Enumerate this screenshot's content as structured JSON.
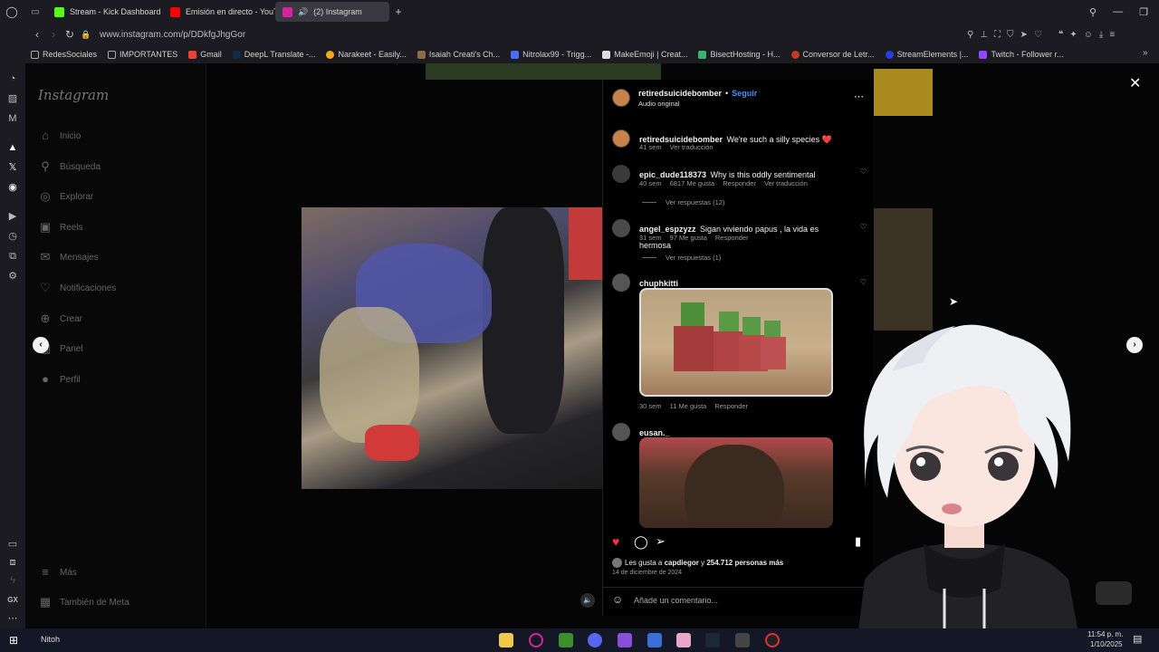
{
  "browser": {
    "tabs": [
      {
        "label": "Stream - Kick Dashboard",
        "color": "#53fc18"
      },
      {
        "label": "Emisión en directo - YouT",
        "color": "#ff0000"
      },
      {
        "label": "(2) Instagram",
        "color": "#d6249f"
      }
    ],
    "url": "www.instagram.com/p/DDkfgJhgGor",
    "bookmarks": [
      "RedesSociales",
      "IMPORTANTES",
      "Gmail",
      "DeepL Translate -...",
      "Narakeet - Easily...",
      "Isaiah Creati's Ch...",
      "Nitrolax99 - Trigg...",
      "MakeEmoji | Creat...",
      "BisectHosting - H...",
      "Conversor de Letr...",
      "StreamElements |...",
      "Twitch - Follower r..."
    ]
  },
  "instagram": {
    "logo": "Instagram",
    "nav": [
      {
        "label": "Inicio",
        "icon": "home-icon",
        "glyph": "⌂"
      },
      {
        "label": "Búsqueda",
        "icon": "search-icon",
        "glyph": "⚲"
      },
      {
        "label": "Explorar",
        "icon": "compass-icon",
        "glyph": "◎"
      },
      {
        "label": "Reels",
        "icon": "reels-icon",
        "glyph": "▣"
      },
      {
        "label": "Mensajes",
        "icon": "messenger-icon",
        "glyph": "✉"
      },
      {
        "label": "Notificaciones",
        "icon": "heart-icon",
        "glyph": "♡"
      },
      {
        "label": "Crear",
        "icon": "plus-icon",
        "glyph": "⊕"
      },
      {
        "label": "Panel",
        "icon": "chart-icon",
        "glyph": "▥"
      },
      {
        "label": "Perfil",
        "icon": "profile-icon",
        "glyph": "●"
      }
    ],
    "more": "Más",
    "meta": "También de Meta"
  },
  "post": {
    "author": "retiredsuicidebomber",
    "follow": "Seguir",
    "audio": "Audio original",
    "caption": {
      "user": "retiredsuicidebomber",
      "text": "We're such a silly species ❤️",
      "time": "41 sem",
      "translate": "Ver traducción"
    },
    "comments": [
      {
        "user": "epic_dude118373",
        "text": "Why is this oddly sentimental",
        "time": "40 sem",
        "likes": "6817 Me gusta",
        "reply": "Responder",
        "translate": "Ver traducción",
        "replies": "Ver respuestas (12)"
      },
      {
        "user": "angel_espzyzz",
        "text": "Sigan viviendo papus , la vida es hermosa",
        "time": "31 sem",
        "likes": "97 Me gusta",
        "reply": "Responder",
        "replies": "Ver respuestas (1)"
      },
      {
        "user": "chuphkitti",
        "text": "",
        "time": "30 sem",
        "likes": "11 Me gusta",
        "reply": "Responder"
      },
      {
        "user": "eusan._",
        "text": ""
      }
    ],
    "likes_line": {
      "prefix": "Les gusta a",
      "user": "capdiegor",
      "mid": "y",
      "count": "254.712 personas más"
    },
    "date": "14 de diciembre de 2024",
    "comment_placeholder": "Añade un comentario..."
  },
  "taskbar": {
    "label": "Nitoh",
    "time": "11:54 p. m.",
    "date": "1/10/2025"
  }
}
